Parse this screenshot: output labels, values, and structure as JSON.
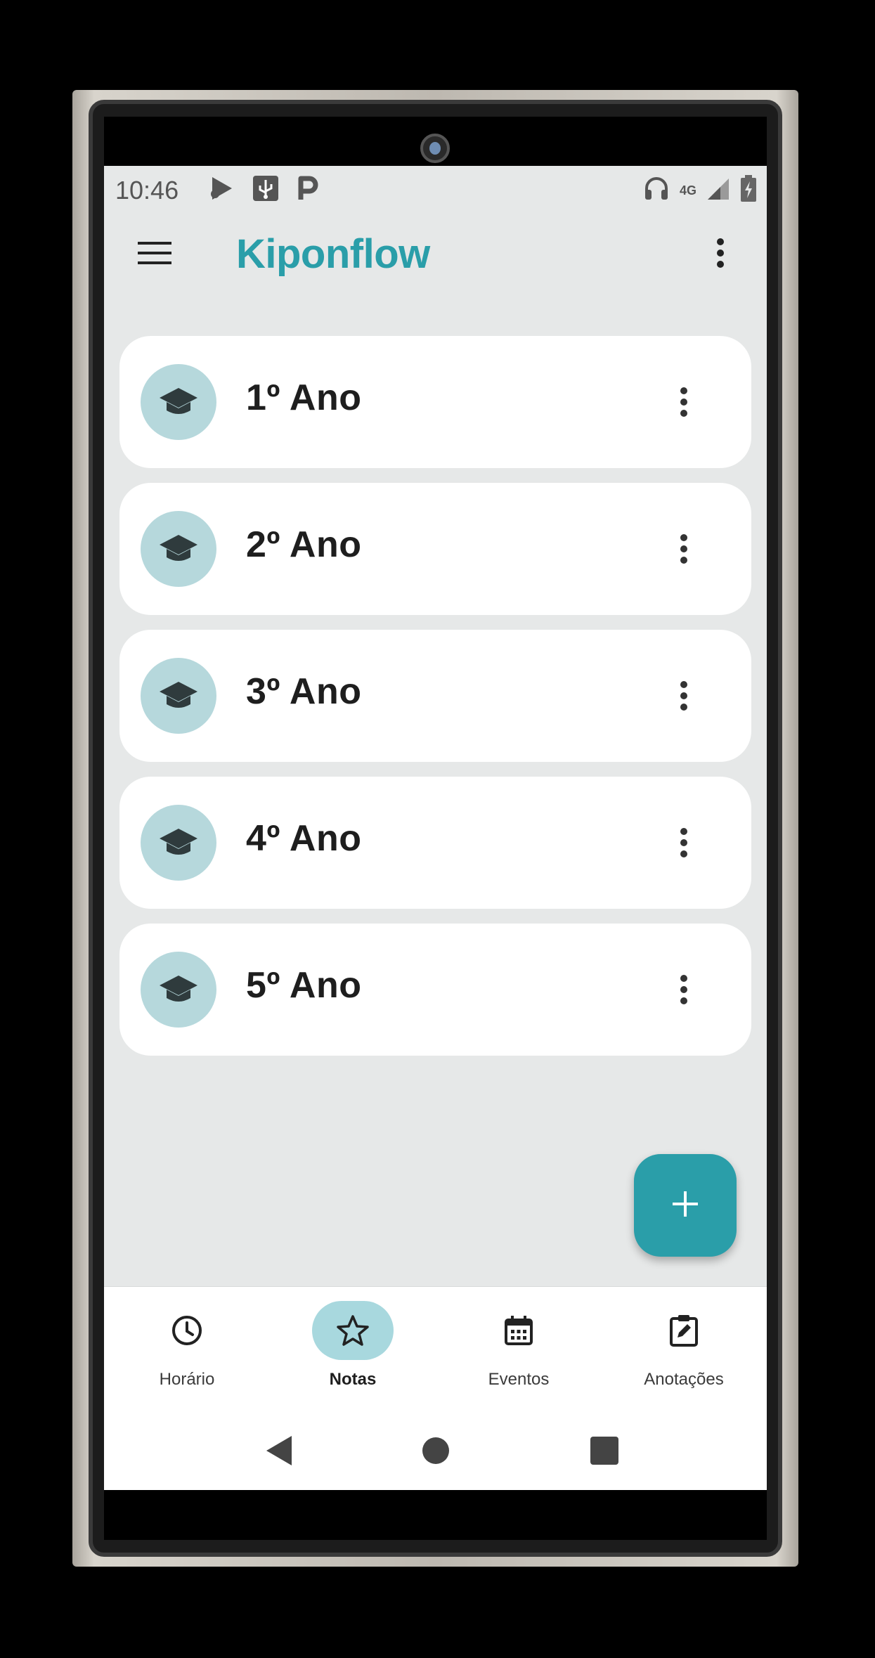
{
  "status_bar": {
    "time": "10:46",
    "network_label": "4G",
    "left_icons": [
      "music-icon",
      "usb-icon",
      "parking-p-icon"
    ],
    "right_icons": [
      "headphones-icon",
      "network-4g-icon",
      "signal-icon",
      "battery-charging-icon"
    ]
  },
  "app_bar": {
    "title": "Kiponflow",
    "menu_icon": "hamburger-menu-icon",
    "overflow_icon": "more-vertical-icon"
  },
  "years": [
    {
      "label": "1º Ano",
      "icon": "graduation-cap-icon"
    },
    {
      "label": "2º Ano",
      "icon": "graduation-cap-icon"
    },
    {
      "label": "3º Ano",
      "icon": "graduation-cap-icon"
    },
    {
      "label": "4º Ano",
      "icon": "graduation-cap-icon"
    },
    {
      "label": "5º Ano",
      "icon": "graduation-cap-icon"
    }
  ],
  "fab": {
    "icon": "plus-icon"
  },
  "bottom_nav": {
    "active": "Notas",
    "items": [
      {
        "label": "Horário",
        "icon": "clock-icon"
      },
      {
        "label": "Notas",
        "icon": "star-icon"
      },
      {
        "label": "Eventos",
        "icon": "calendar-icon"
      },
      {
        "label": "Anotações",
        "icon": "clipboard-edit-icon"
      }
    ]
  },
  "system_nav": [
    "back-icon",
    "home-icon",
    "recents-icon"
  ],
  "colors": {
    "accent": "#2a9ea9",
    "screen_background": "#e6e8e8",
    "card": "#ffffff",
    "avatar_background": "#b6d8dc",
    "nav_active_pill": "#a8d8de",
    "text_primary": "#1e1e1e"
  }
}
